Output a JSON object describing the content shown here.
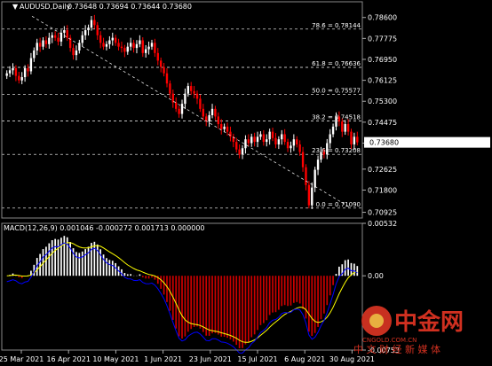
{
  "header": {
    "title": "AUDUSD,Daily",
    "ohlc": "0.73648 0.73694 0.73644 0.73680"
  },
  "macd_header": "MACD(12,26,9) 0.001046 -0.000272 0.001713 0.000000",
  "colors": {
    "background": "#000000",
    "bull_candle": "#ffffff",
    "bear_candle": "#ff0000",
    "fib_line": "#ffffff",
    "trendline": "#ffffff",
    "macd_pos": "#ffffff",
    "macd_neg": "#cc0000",
    "signal_line": "#ffff00",
    "macd_line": "#0000ff",
    "last_price_bg": "#ffffff"
  },
  "watermark": {
    "logo_text": "中金网",
    "site": "CNGOLD.COM.CN",
    "tagline": "中 文 财 经 新 媒 体"
  },
  "chart_data": [
    {
      "type": "candlestick",
      "symbol": "AUDUSD",
      "timeframe": "Daily",
      "last_price": "0.73680",
      "y_ticks": [
        "0.78600",
        "0.77775",
        "0.76950",
        "0.76125",
        "0.75300",
        "0.74475",
        "0.73650",
        "0.72625",
        "0.71800",
        "0.70925"
      ],
      "ylim": [
        0.707,
        0.788
      ],
      "x_ticks": [
        "25 Mar 2021",
        "16 Apr 2021",
        "10 May 2021",
        "1 Jun 2021",
        "23 Jun 2021",
        "15 Jul 2021",
        "6 Aug 2021",
        "30 Aug 2021"
      ],
      "fib_levels": [
        {
          "label": "78.6 = 0.78144",
          "value": 0.78144
        },
        {
          "label": "61.8 = 0.76636",
          "value": 0.76636
        },
        {
          "label": "50.0 = 0.75577",
          "value": 0.75577
        },
        {
          "label": "38.2 = 0.74518",
          "value": 0.74518
        },
        {
          "label": "23.6 = 0.73208",
          "value": 0.73208
        },
        {
          "label": "0.0 = 0.71090",
          "value": 0.7109
        }
      ],
      "trendline": [
        [
          0.7865,
          0
        ],
        [
          0.7112,
          1
        ]
      ],
      "closes": [
        0.764,
        0.7652,
        0.766,
        0.763,
        0.7612,
        0.7625,
        0.766,
        0.7648,
        0.77,
        0.773,
        0.776,
        0.7745,
        0.777,
        0.7755,
        0.778,
        0.779,
        0.778,
        0.7765,
        0.78,
        0.781,
        0.778,
        0.774,
        0.7712,
        0.773,
        0.776,
        0.779,
        0.781,
        0.782,
        0.785,
        0.783,
        0.779,
        0.776,
        0.7745,
        0.7755,
        0.777,
        0.778,
        0.776,
        0.7745,
        0.774,
        0.7725,
        0.7745,
        0.776,
        0.774,
        0.7755,
        0.777,
        0.772,
        0.7735,
        0.7745,
        0.776,
        0.772,
        0.769,
        0.7665,
        0.764,
        0.76,
        0.756,
        0.7525,
        0.75,
        0.748,
        0.752,
        0.756,
        0.759,
        0.757,
        0.756,
        0.754,
        0.75,
        0.747,
        0.745,
        0.7475,
        0.75,
        0.747,
        0.744,
        0.742,
        0.743,
        0.741,
        0.739,
        0.737,
        0.734,
        0.732,
        0.7345,
        0.738,
        0.7365,
        0.739,
        0.737,
        0.739,
        0.74,
        0.737,
        0.738,
        0.741,
        0.7385,
        0.736,
        0.738,
        0.74,
        0.737,
        0.7345,
        0.7355,
        0.738,
        0.736,
        0.733,
        0.727,
        0.72,
        0.712,
        0.719,
        0.726,
        0.73,
        0.733,
        0.732,
        0.7365,
        0.74,
        0.743,
        0.747,
        0.745,
        0.741,
        0.744,
        0.741,
        0.736,
        0.739,
        0.7368
      ],
      "macd": {
        "header_values": [
          "0.001046",
          "-0.000272",
          "0.001713",
          "0.000000"
        ],
        "y_ticks": [
          "0.00532",
          "0.00",
          "-0.00753"
        ],
        "ylim": [
          -0.00753,
          0.00532
        ]
      }
    }
  ]
}
